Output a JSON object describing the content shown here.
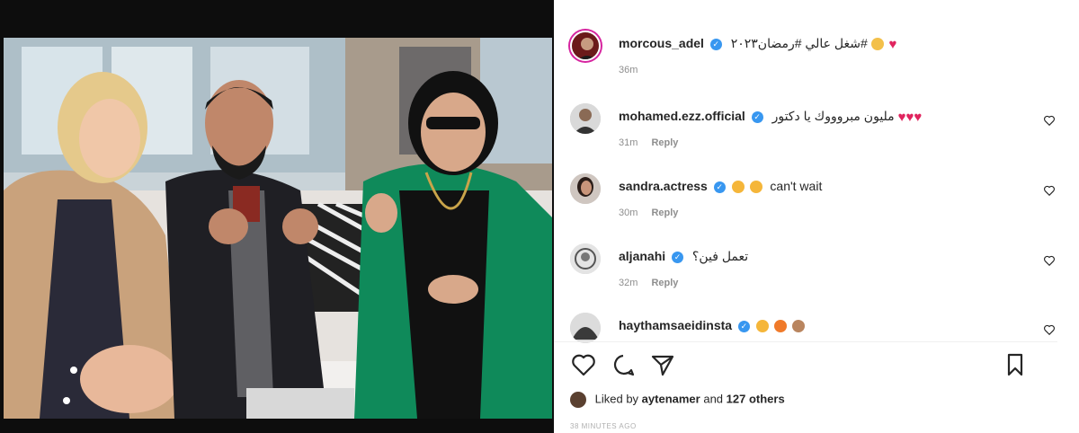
{
  "post": {
    "author": "morcous_adel",
    "caption": "شغل عالي #رمضان٢٠٢٣#",
    "time": "36m"
  },
  "comments": [
    {
      "username": "mohamed.ezz.official",
      "text": "مليون مبروووك يا دكتور",
      "time": "31m",
      "reply": "Reply"
    },
    {
      "username": "sandra.actress",
      "text": "can't wait",
      "time": "30m",
      "reply": "Reply"
    },
    {
      "username": "aljanahi",
      "text": "تعمل فين؟",
      "time": "32m",
      "reply": "Reply"
    },
    {
      "username": "haythamsaeidinsta",
      "text": "",
      "time": "",
      "reply": ""
    }
  ],
  "likes": {
    "liked_by_prefix": "Liked by",
    "liked_by_user": "aytenamer",
    "and_word": "and",
    "others": "127 others"
  },
  "time_ago": "38 MINUTES AGO",
  "icons": {
    "like": "heart-outline-icon",
    "comment": "comment-bubble-icon",
    "share": "paper-plane-icon",
    "save": "bookmark-icon",
    "verified": "verified-badge-icon"
  },
  "colors": {
    "verified": "#3897f0",
    "heart": "#e0245e",
    "muted": "#8e8e8e"
  }
}
